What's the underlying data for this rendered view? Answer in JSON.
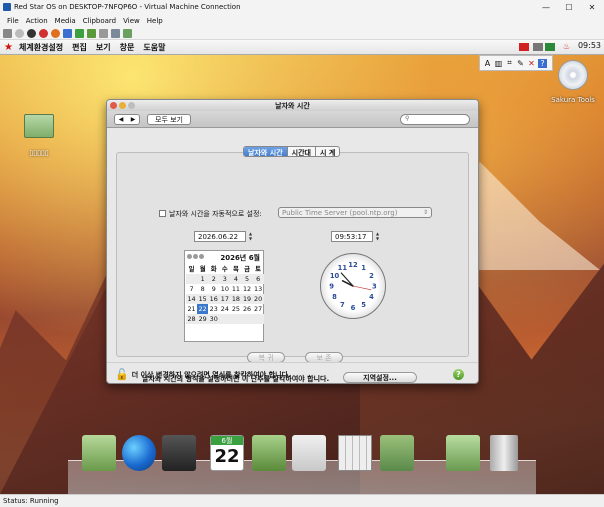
{
  "host": {
    "title": "Red Star OS on DESKTOP-7NFQP6O - Virtual Machine Connection",
    "controls": {
      "minimize": "—",
      "maximize": "☐",
      "close": "✕"
    },
    "menu": [
      "File",
      "Action",
      "Media",
      "Clipboard",
      "View",
      "Help"
    ],
    "status": "Status: Running"
  },
  "guest_menubar": {
    "star": "★",
    "items": [
      "체계환경설정",
      "편집",
      "보기",
      "창문",
      "도움말"
    ],
    "clock": "09:53",
    "clock_icon": "♨"
  },
  "tray": [
    "A",
    "▥",
    "⌗",
    "✎",
    "✕",
    "?"
  ],
  "desktop": {
    "disc_label": "Sakura Tools",
    "folder_label": "▯▯▯▯▯"
  },
  "window": {
    "title": "날자와 시간",
    "nav": {
      "back": "◀",
      "forward": "▶"
    },
    "show_all": "모두 보기",
    "tabs": [
      "날자와 시간",
      "시간대",
      "시 계"
    ],
    "auto_set_label": "날자와 시간을 자동적으로 설정:",
    "time_server": "Public Time Server (pool.ntp.org)",
    "date_value": "2026.06.22",
    "time_value": "09:53:17",
    "calendar": {
      "header": "2026년 6월",
      "days_of_week": [
        "일",
        "월",
        "화",
        "수",
        "목",
        "금",
        "토"
      ],
      "weeks": [
        [
          "",
          "1",
          "2",
          "3",
          "4",
          "5",
          "6"
        ],
        [
          "7",
          "8",
          "9",
          "10",
          "11",
          "12",
          "13"
        ],
        [
          "14",
          "15",
          "16",
          "17",
          "18",
          "19",
          "20"
        ],
        [
          "21",
          "22",
          "23",
          "24",
          "25",
          "26",
          "27"
        ],
        [
          "28",
          "29",
          "30",
          "",
          "",
          "",
          ""
        ]
      ],
      "selected_day": "22"
    },
    "clock": {
      "hours": [
        "12",
        "1",
        "2",
        "3",
        "4",
        "5",
        "6",
        "7",
        "8",
        "9",
        "10",
        "11"
      ],
      "hour": 9,
      "minute": 53,
      "second": 17
    },
    "revert_label": "복 귀",
    "save_label": "보 존",
    "format_hint": "날자와 시간의 형식을 설정하려면 이 단추를 찰칵하여야 합니다.",
    "region_button": "지역설정...",
    "lock_text": "더 이상 변경하지 않으려면 열쇠를 찰칵하여야 합니다.",
    "help": "?"
  },
  "dock_icons": [
    "address-book-icon",
    "browser-globe-icon",
    "media-player-icon",
    "calendar-icon",
    "contacts-icon",
    "preview-icon",
    "calculator-icon",
    "utilities-icon",
    "trash-folder-icon",
    "trash-icon"
  ],
  "dock_calendar_day": "22",
  "dock_calendar_month": "6월"
}
